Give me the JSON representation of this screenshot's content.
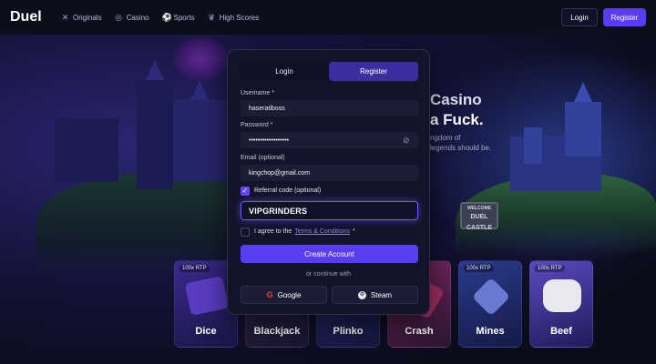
{
  "header": {
    "logo": "Duel",
    "nav": [
      {
        "label": "Originals",
        "icon": "crossed-swords-icon",
        "glyph": "✕"
      },
      {
        "label": "Casino",
        "icon": "casino-chip-icon",
        "glyph": "◎"
      },
      {
        "label": "Sports",
        "icon": "ball-icon",
        "glyph": "⚽"
      },
      {
        "label": "High Scores",
        "icon": "trophy-icon",
        "glyph": "♛"
      }
    ],
    "login_label": "Login",
    "register_label": "Register"
  },
  "hero": {
    "line1": "Casino",
    "line2": "a Fuck.",
    "sub1": "ngdom of",
    "sub2": "legends should be."
  },
  "sign": {
    "top": "WELCOME",
    "text": "DUEL CASTLE"
  },
  "auth": {
    "tabs": [
      {
        "label": "Login",
        "active": false
      },
      {
        "label": "Register",
        "active": true
      }
    ],
    "username_label": "Username *",
    "username_value": "haseratiboss",
    "password_label": "Password *",
    "password_value": "••••••••••••••••••",
    "email_label": "Email (optional)",
    "email_value": "kingchop@gmail.com",
    "referral_label": "Referral code (optional)",
    "referral_checked": true,
    "referral_value": "VIPGRINDERS",
    "agree_prefix": "I agree to the",
    "agree_link": "Terms & Conditions",
    "agree_suffix": "*",
    "agree_checked": false,
    "create_label": "Create Account",
    "or_label": "or continue with",
    "google_label": "Google",
    "steam_label": "Steam"
  },
  "games": [
    {
      "name": "Dice",
      "rtp": "100x RTP",
      "color": "#3a2a8c"
    },
    {
      "name": "Blackjack",
      "rtp": "",
      "color": "#3b2a55"
    },
    {
      "name": "Plinko",
      "rtp": "",
      "color": "#2b2f77"
    },
    {
      "name": "Crash",
      "rtp": "",
      "color": "#6a2a5a"
    },
    {
      "name": "Mines",
      "rtp": "100x RTP",
      "color": "#2b3a8c"
    },
    {
      "name": "Beef",
      "rtp": "100x RTP",
      "color": "#4a3aa8"
    }
  ],
  "colors": {
    "accent": "#5b3df0",
    "background": "#0b0c1a",
    "panel": "#13142a"
  }
}
